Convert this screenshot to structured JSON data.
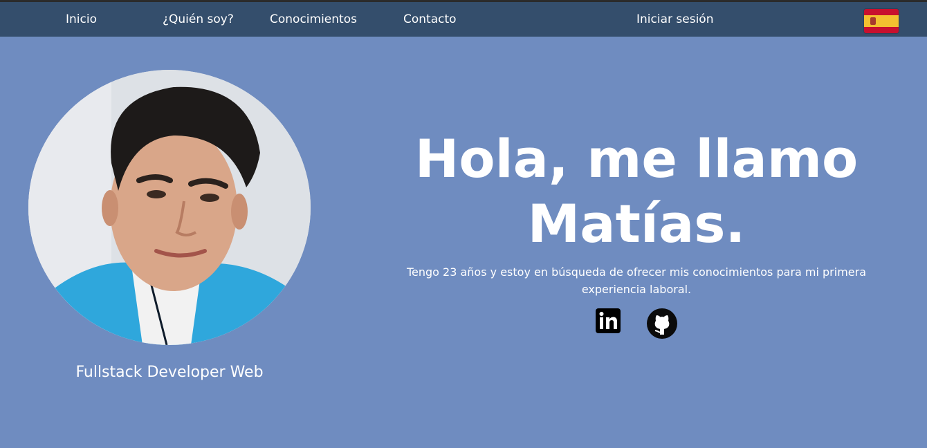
{
  "nav": {
    "items": [
      {
        "label": "Inicio"
      },
      {
        "label": "¿Quién soy?"
      },
      {
        "label": "Conocimientos"
      },
      {
        "label": "Contacto"
      }
    ],
    "login_label": "Iniciar sesión",
    "language_icon": "spain-flag-icon"
  },
  "hero": {
    "headline_line1": "Hola, me llamo",
    "headline_line2": "Matías.",
    "bio": "Tengo 23 años y estoy en búsqueda de ofrecer mis conocimientos para mi primera experiencia laboral.",
    "role": "Fullstack Developer Web",
    "social": [
      {
        "icon": "linkedin-icon"
      },
      {
        "icon": "github-icon"
      }
    ]
  },
  "colors": {
    "topbar": "#344e6c",
    "background": "#6f8cc0",
    "text": "#ffffff"
  }
}
